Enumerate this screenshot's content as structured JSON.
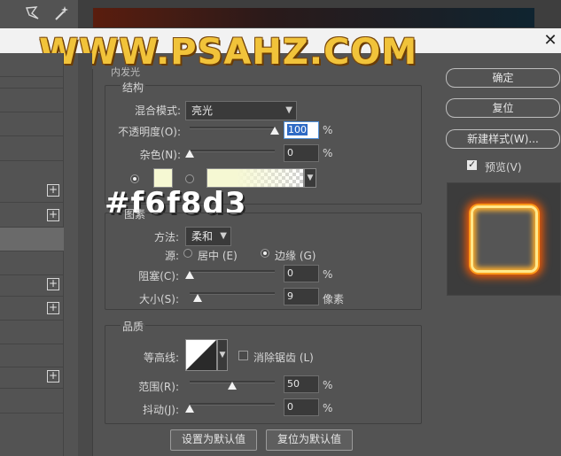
{
  "watermark": "WWW.PSAHZ.COM",
  "annotation_hex": "#f6f8d3",
  "dialog": {
    "section_title": "内发光",
    "structure": {
      "title": "结构",
      "blend_mode_label": "混合模式:",
      "blend_mode_value": "亮光",
      "opacity_label": "不透明度(O):",
      "opacity_value": "100",
      "opacity_unit": "%",
      "noise_label": "杂色(N):",
      "noise_value": "0",
      "noise_unit": "%",
      "glow_color": "#f6f8d3"
    },
    "elements": {
      "title": "图素",
      "method_label": "方法:",
      "method_value": "柔和",
      "source_label": "源:",
      "source_center": "居中 (E)",
      "source_edge": "边缘 (G)",
      "choke_label": "阻塞(C):",
      "choke_value": "0",
      "choke_unit": "%",
      "size_label": "大小(S):",
      "size_value": "9",
      "size_unit": "像素"
    },
    "quality": {
      "title": "品质",
      "contour_label": "等高线:",
      "anti_alias_label": "消除锯齿 (L)",
      "range_label": "范围(R):",
      "range_value": "50",
      "range_unit": "%",
      "jitter_label": "抖动(J):",
      "jitter_value": "0",
      "jitter_unit": "%"
    },
    "buttons": {
      "make_default": "设置为默认值",
      "reset_default": "复位为默认值"
    }
  },
  "right_buttons": {
    "ok": "确定",
    "reset": "复位",
    "new_style": "新建样式(W)...",
    "preview_label": "预览(V)"
  },
  "sliders": {
    "opacity": 100,
    "noise": 0,
    "choke": 0,
    "size": 9,
    "range": 50,
    "jitter": 0
  }
}
